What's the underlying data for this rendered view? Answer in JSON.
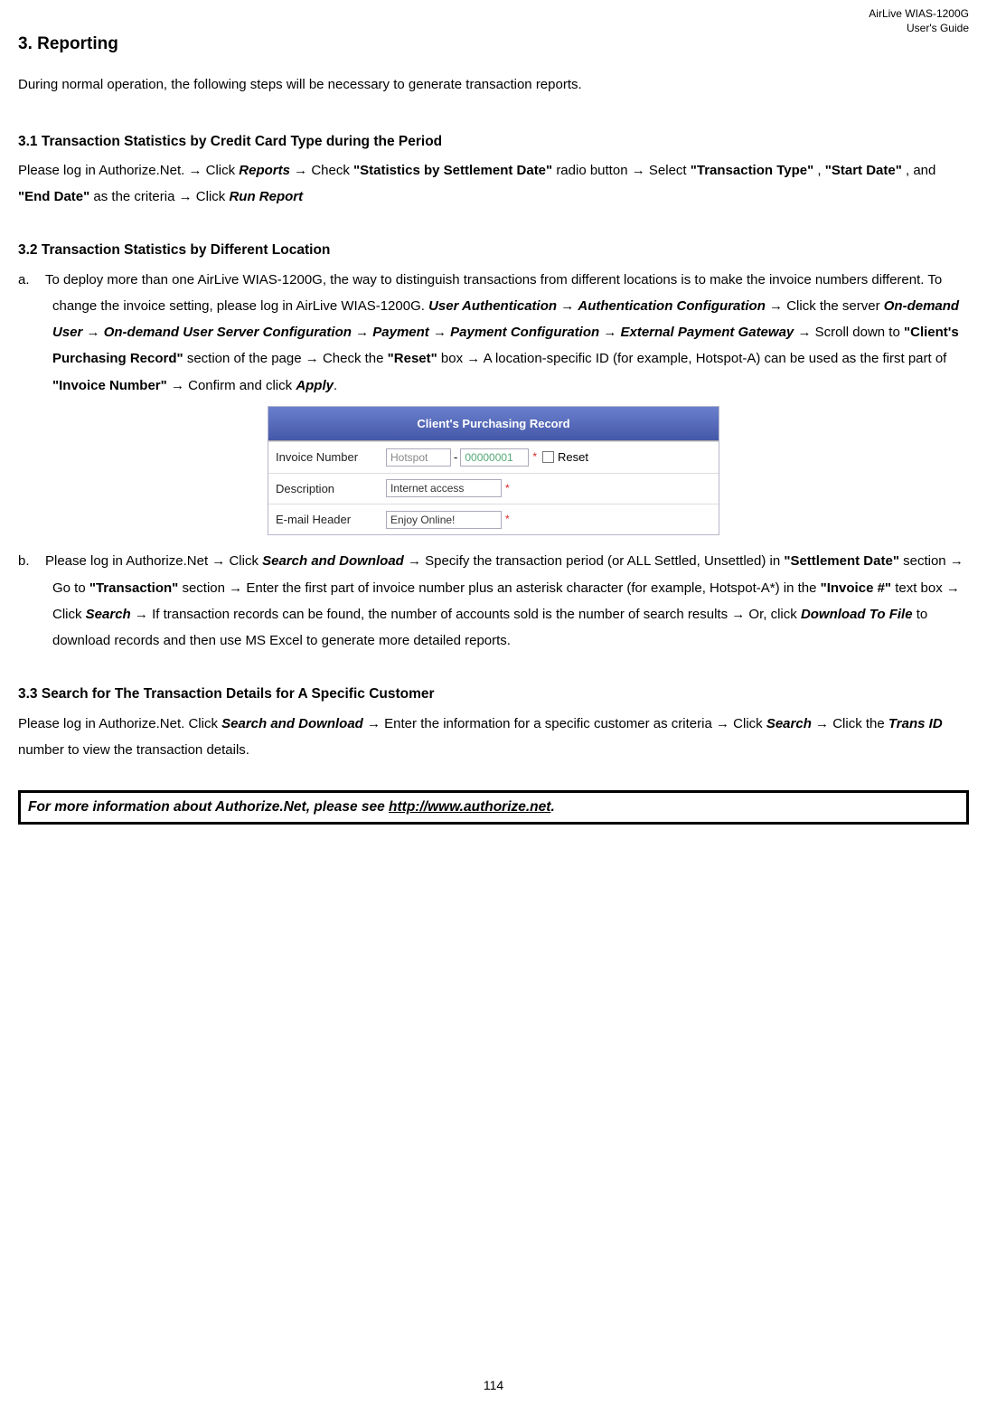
{
  "header": {
    "line1": "AirLive WIAS-1200G",
    "line2": "User's Guide"
  },
  "h2": "3.  Reporting",
  "intro": "During normal operation, the following steps will be necessary to generate transaction reports.",
  "s31": {
    "heading": "3.1 Transaction Statistics by Credit Card Type during the Period",
    "t1": "Please log in Authorize.Net. ",
    "t2": " Click ",
    "reports": "Reports",
    "t3": " Check ",
    "stats": "\"Statistics by Settlement Date\"",
    "t4": " radio button ",
    "t5": " Select ",
    "ttype": "\"Transaction Type\"",
    "comma1": ", ",
    "sdate": "\"Start Date\"",
    "comma2": ", and ",
    "edate": "\"End Date\"",
    "t6": " as the criteria ",
    "t7": " Click ",
    "run": "Run Report"
  },
  "s32": {
    "heading": "3.2 Transaction Statistics by Different Location",
    "a_marker": "a.",
    "a_t1": "To deploy more than one AirLive WIAS-1200G, the way to distinguish transactions from different locations is to make the invoice numbers different. To change the invoice setting, please log in AirLive WIAS-1200G. ",
    "ua": "User Authentication",
    "ac": "Authentication Configuration",
    "a_t2": " Click the server ",
    "odu": "On-demand User",
    "odusc": "On-demand User Server Configuration",
    "pay": "Payment",
    "payconf": "Payment Configuration",
    "epg": "External Payment Gateway",
    "a_t3": " Scroll down to ",
    "cpr": "\"Client's Purchasing Record\"",
    "a_t4": " section of the page ",
    "a_t5": " Check the ",
    "reset": "\"Reset\"",
    "a_t6": " box ",
    "a_t7": " A location-specific ID (for example, Hotspot-A) can be used as the first part of ",
    "inv": "\"Invoice Number\"",
    "a_t8": " Confirm and click ",
    "apply": "Apply",
    "a_t9": ".",
    "b_marker": "b.",
    "b_t1": "Please log in Authorize.Net ",
    "b_t2": " Click ",
    "sad": "Search and Download",
    "b_t3": " Specify the transaction period (or ALL Settled, Unsettled) in ",
    "setdate": "\"Settlement Date\"",
    "b_t4": " section ",
    "b_t5": " Go to ",
    "trans": "\"Transaction\"",
    "b_t6": " section ",
    "b_t7": " Enter the first part of invoice number plus an asterisk character (for example, Hotspot-A*) in the ",
    "invnum": "\"Invoice #\"",
    "b_t8": " text box ",
    "b_t9": " Click ",
    "search": "Search",
    "b_t10": " If transaction records can be found, the number of accounts sold is the number of search results ",
    "b_t11": " Or, click ",
    "dtf": "Download To File",
    "b_t12": " to download records and then use MS Excel to generate more detailed reports."
  },
  "figure": {
    "title": "Client's Purchasing Record",
    "row1_label": "Invoice Number",
    "row1_input1": "Hotspot",
    "row1_input2": "00000001",
    "row1_reset": "Reset",
    "row2_label": "Description",
    "row2_input": "Internet access",
    "row3_label": "E-mail Header",
    "row3_input": "Enjoy Online!"
  },
  "s33": {
    "heading": "3.3 Search for The Transaction Details for A Specific Customer",
    "t1": "Please log in Authorize.Net. Click ",
    "sad": "Search and Download",
    "t2": " Enter the information for a specific customer as criteria ",
    "t3": " Click ",
    "search": "Search",
    "t4": " Click the ",
    "tid": "Trans ID",
    "t5": " number to view the transaction details."
  },
  "note": {
    "t1": "For more information about Authorize.Net, please see ",
    "url": "http://www.authorize.net",
    "t2": "."
  },
  "arrow": "→",
  "page": "114"
}
